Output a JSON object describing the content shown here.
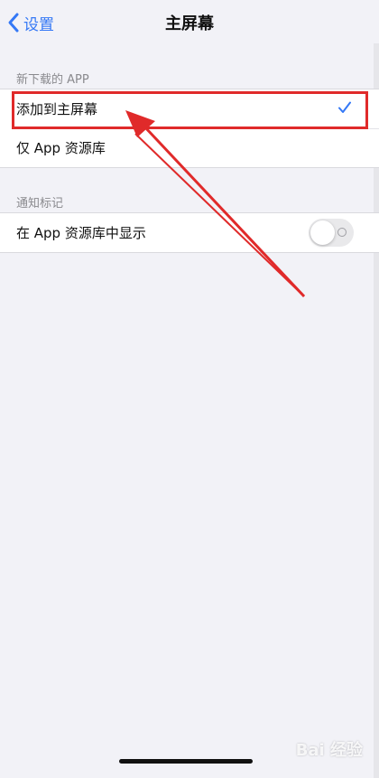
{
  "nav": {
    "back_label": "设置",
    "title": "主屏幕"
  },
  "sections": [
    {
      "header": "新下载的 APP",
      "rows": [
        {
          "label": "添加到主屏幕",
          "selected": true
        },
        {
          "label": "仅 App 资源库",
          "selected": false
        }
      ]
    },
    {
      "header": "通知标记",
      "rows": [
        {
          "label": "在 App 资源库中显示",
          "toggle": false
        }
      ]
    }
  ],
  "watermark": "Bai 经验",
  "colors": {
    "accent": "#3478f6",
    "annotation": "#e02a2a",
    "background": "#f2f2f7"
  },
  "icons": {
    "back": "chevron-left-icon",
    "check": "checkmark-icon"
  }
}
